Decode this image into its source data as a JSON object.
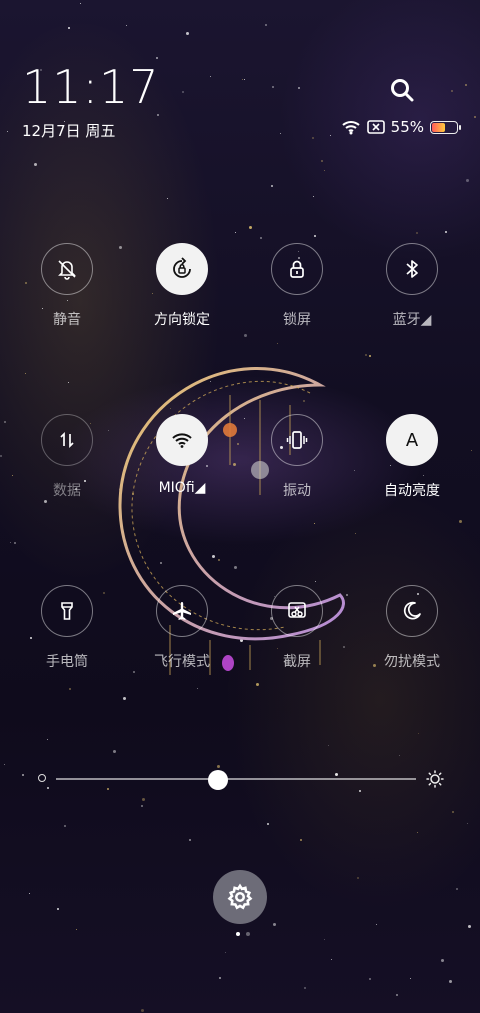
{
  "header": {
    "time": "11:17",
    "date": "12月7日 周五",
    "battery_text": "55%",
    "battery_level": 0.55
  },
  "tiles": [
    {
      "label": "静音",
      "icon": "bell-off-icon",
      "active": false
    },
    {
      "label": "方向锁定",
      "icon": "rotation-lock-icon",
      "active": true
    },
    {
      "label": "锁屏",
      "icon": "lock-icon",
      "active": false
    },
    {
      "label": "蓝牙◢",
      "icon": "bluetooth-icon",
      "active": false
    },
    {
      "label": "数据",
      "icon": "mobile-data-icon",
      "active": false
    },
    {
      "label": "MIOfi◢",
      "icon": "wifi-icon",
      "active": true
    },
    {
      "label": "振动",
      "icon": "vibrate-icon",
      "active": false
    },
    {
      "label": "自动亮度",
      "icon": "auto-brightness-icon",
      "active": true,
      "glyph": "A"
    },
    {
      "label": "手电筒",
      "icon": "flashlight-icon",
      "active": false
    },
    {
      "label": "飞行模式",
      "icon": "airplane-icon",
      "active": false
    },
    {
      "label": "截屏",
      "icon": "screenshot-icon",
      "active": false
    },
    {
      "label": "勿扰模式",
      "icon": "moon-icon",
      "active": false
    }
  ],
  "brightness": {
    "level": 0.45
  },
  "pager": {
    "pages": 2,
    "current": 1
  },
  "colors": {
    "active_tile": "#f2f2f2",
    "accent_gold": "#d8b25a"
  }
}
